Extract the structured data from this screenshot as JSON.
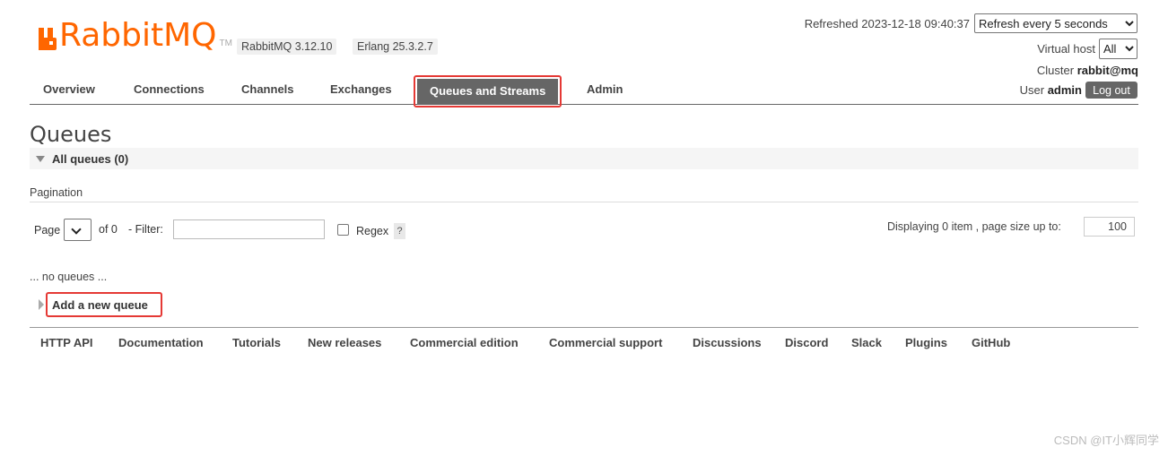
{
  "header": {
    "logo_text": "RabbitMQ",
    "logo_tm": "TM",
    "rabbitmq_version": "RabbitMQ 3.12.10",
    "erlang_version": "Erlang 25.3.2.7",
    "refreshed": "Refreshed 2023-12-18 09:40:37",
    "refresh_select": "Refresh every 5 seconds",
    "vhost_label": "Virtual host",
    "vhost_select": "All",
    "cluster_label": "Cluster",
    "cluster_name": "rabbit@mq",
    "user_label": "User",
    "user_name": "admin",
    "logout_label": "Log out"
  },
  "nav": {
    "tabs": [
      {
        "label": "Overview"
      },
      {
        "label": "Connections"
      },
      {
        "label": "Channels"
      },
      {
        "label": "Exchanges"
      },
      {
        "label": "Queues and Streams",
        "active": true
      },
      {
        "label": "Admin"
      }
    ]
  },
  "main": {
    "title": "Queues",
    "section_label": "All queues (0)",
    "pagination_label": "Pagination",
    "page_label": "Page",
    "of_label": "of 0",
    "filter_label": "- Filter:",
    "filter_value": "",
    "regex_label": "Regex",
    "regex_checked": false,
    "help_label": "?",
    "displaying": "Displaying 0 item , page size up to:",
    "page_size": "100",
    "no_queues": "... no queues ...",
    "add_queue_label": "Add a new queue"
  },
  "footer": {
    "links": [
      "HTTP API",
      "Documentation",
      "Tutorials",
      "New releases",
      "Commercial edition",
      "Commercial support",
      "Discussions",
      "Discord",
      "Slack",
      "Plugins",
      "GitHub"
    ]
  },
  "watermark": "CSDN @IT小辉同学",
  "colors": {
    "brand": "#ff6600",
    "active_tab": "#666666",
    "highlight": "#e53935"
  }
}
